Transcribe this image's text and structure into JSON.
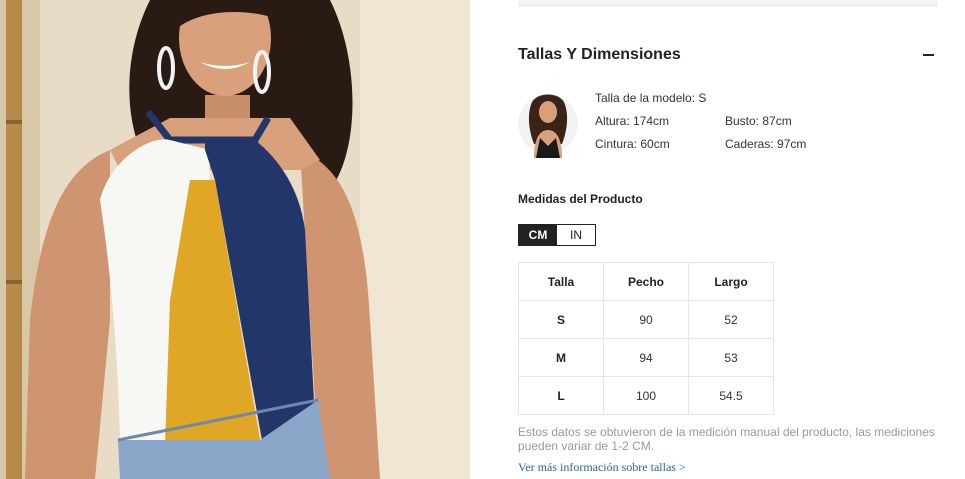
{
  "product_image": {
    "icon": "model-wearing-colorblock-halter-top"
  },
  "size_section": {
    "title": "Tallas Y Dimensiones",
    "collapse_icon": "minus-icon"
  },
  "model": {
    "avatar_icon": "model-avatar",
    "size": "Talla de la modelo: S",
    "height": "Altura: 174cm",
    "bust": "Busto: 87cm",
    "waist": "Cintura: 60cm",
    "hips": "Caderas: 97cm"
  },
  "measurements": {
    "title": "Medidas del Producto",
    "units": [
      "CM",
      "IN"
    ],
    "selected_unit": "CM",
    "headers": [
      "Talla",
      "Pecho",
      "Largo"
    ],
    "rows": [
      [
        "S",
        "90",
        "52"
      ],
      [
        "M",
        "94",
        "53"
      ],
      [
        "L",
        "100",
        "54.5"
      ]
    ]
  },
  "note": "Estos datos se obtuvieron de la medición manual del producto, las mediciones pueden variar de 1-2 CM.",
  "more_link": "Ver más información sobre tallas >",
  "colors": {
    "navy": "#22366a",
    "mustard": "#e0a625",
    "white": "#f7f7f4",
    "wall": "#e8dcc6",
    "link": "#2d5fa8",
    "toggle_active": "#222222"
  }
}
